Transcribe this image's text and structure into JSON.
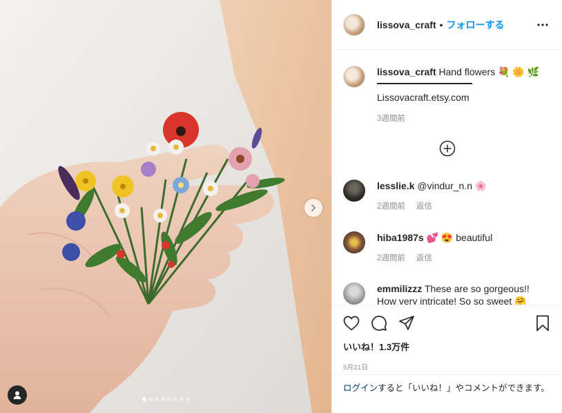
{
  "header": {
    "username": "lissova_craft",
    "separator": "•",
    "follow_label": "フォローする"
  },
  "caption": {
    "username": "lissova_craft",
    "text": "Hand flowers 💐 🌼 🌿",
    "link": "Lissovacraft.etsy.com",
    "time": "3週間前"
  },
  "comments": [
    {
      "username": "lesslie.k",
      "text": "@vindur_n.n 🌸",
      "time": "2週間前",
      "reply": "返信"
    },
    {
      "username": "hiba1987s",
      "text": "💕 😍 beautiful",
      "time": "2週間前",
      "reply": "返信"
    },
    {
      "username": "emmilizzz",
      "text": "These are so gorgeous!! How very intricate! So so sweet 🤗",
      "time": "",
      "reply": ""
    }
  ],
  "likes": "いいね！1.3万件",
  "date": "5月21日",
  "login": {
    "link": "ログイン",
    "text": "すると「いいね！」やコメントができます。"
  },
  "carousel": {
    "count": 8,
    "active_index": 0
  },
  "icons": [
    "more-icon",
    "add-comment-icon",
    "heart-icon",
    "comment-icon",
    "share-icon",
    "bookmark-icon",
    "next-arrow-icon",
    "user-tag-icon"
  ],
  "colors": {
    "link": "#0095f6",
    "text": "#262626",
    "muted": "#8e8e8e",
    "border": "#efefef",
    "login_link": "#00376b"
  }
}
